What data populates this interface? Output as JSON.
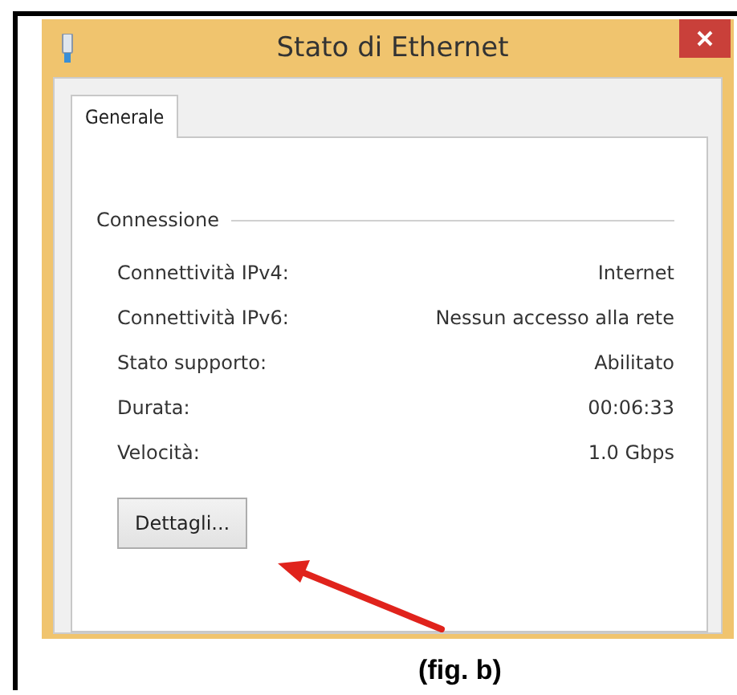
{
  "window": {
    "title": "Stato di Ethernet"
  },
  "tabs": [
    {
      "label": "Generale",
      "selected": true
    }
  ],
  "connection": {
    "title": "Connessione",
    "rows": [
      {
        "label": "Connettività IPv4:",
        "value": "Internet"
      },
      {
        "label": "Connettività IPv6:",
        "value": "Nessun accesso alla rete"
      },
      {
        "label": "Stato supporto:",
        "value": "Abilitato"
      },
      {
        "label": "Durata:",
        "value": "00:06:33"
      },
      {
        "label": "Velocità:",
        "value": "1.0 Gbps"
      }
    ]
  },
  "buttons": [
    "Dettagli..."
  ],
  "caption": "(fig. b)"
}
